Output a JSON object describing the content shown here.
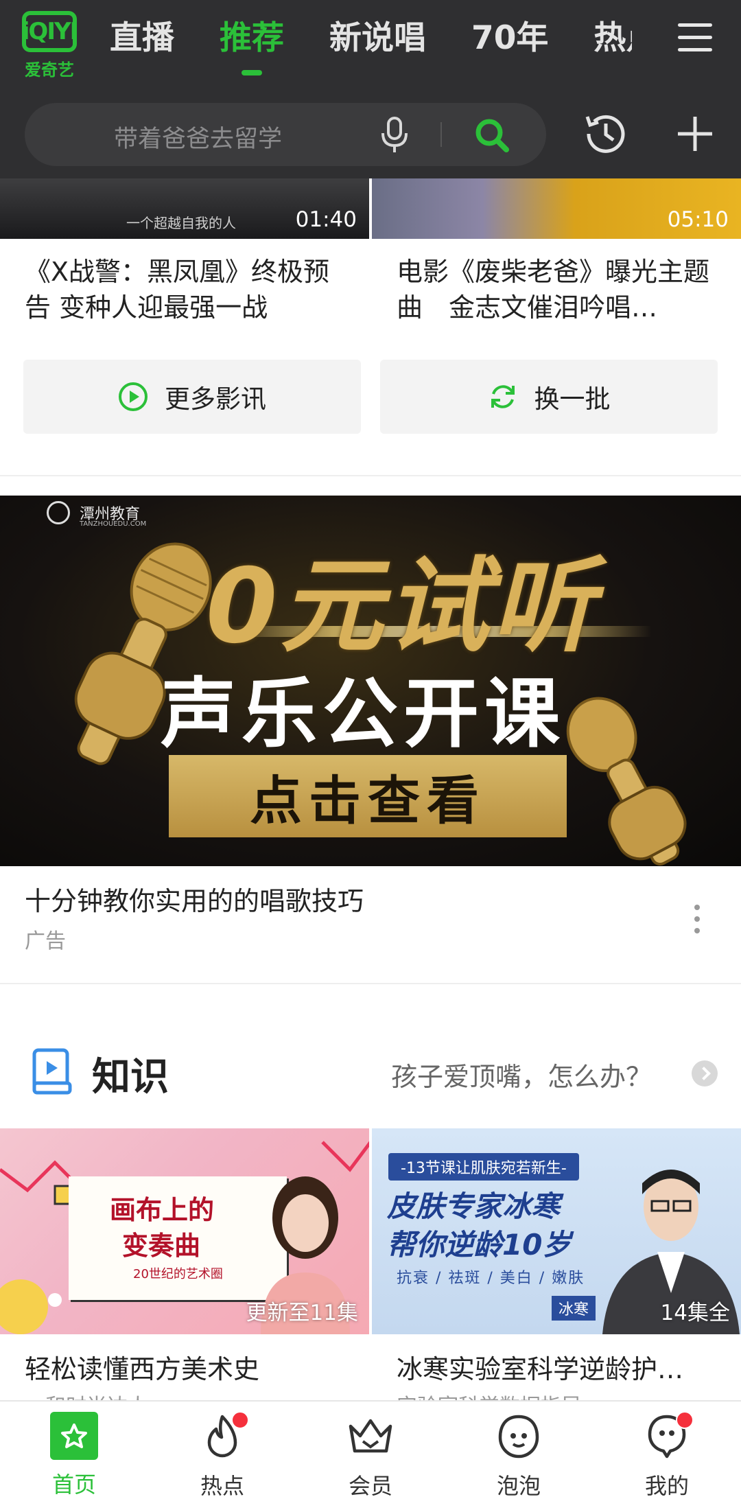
{
  "header": {
    "logo_text": "iQIYI",
    "logo_subtext": "爱奇艺",
    "tabs": [
      "直播",
      "推荐",
      "新说唱",
      "70年",
      "热点"
    ],
    "active_tab_index": 1,
    "accent_color": "#2bc039"
  },
  "search": {
    "placeholder": "带着爸爸去留学",
    "mic_icon": "microphone-icon",
    "search_icon": "search-icon"
  },
  "top_videos": [
    {
      "caption": "一个超越自我的人",
      "duration": "01:40",
      "title": "《X战警：黑凤凰》终极预告 变种人迎最强一战"
    },
    {
      "caption": "",
      "duration": "05:10",
      "title": "电影《废柴老爸》曝光主题曲　金志文催泪吟唱…"
    }
  ],
  "actions": {
    "more_label": "更多影讯",
    "refresh_label": "换一批"
  },
  "ad": {
    "brand": "潭州教育",
    "brand_sub": "TANZHOUEDU.COM",
    "headline": "0元试听",
    "subhead": "声乐公开课",
    "cta": "点击查看",
    "title": "十分钟教你实用的的唱歌技巧",
    "label": "广告"
  },
  "knowledge": {
    "section_title": "知识",
    "promo": "孩子爱顶嘴，怎么办？",
    "cards": [
      {
        "board_line1": "画布上的",
        "board_line2": "变奏曲",
        "board_line3": "20世纪的艺术圈",
        "badge": "更新至11集",
        "title": "轻松读懂西方美术史",
        "subtitle": "…和时尚达人"
      },
      {
        "banner": "-13节课让肌肤宛若新生-",
        "headline1": "皮肤专家冰寒",
        "headline2": "帮你逆龄10岁",
        "sub": "抗衰 / 祛斑 / 美白 / 嫩肤",
        "name": "冰寒",
        "badge": "14集全",
        "title": "冰寒实验室科学逆龄护…",
        "subtitle": "实验室科学数据指导"
      }
    ]
  },
  "bottom_nav": [
    {
      "label": "首页",
      "icon": "home-star-icon",
      "active": true,
      "badge": false
    },
    {
      "label": "热点",
      "icon": "flame-icon",
      "active": false,
      "badge": true
    },
    {
      "label": "会员",
      "icon": "crown-icon",
      "active": false,
      "badge": false
    },
    {
      "label": "泡泡",
      "icon": "bubble-face-icon",
      "active": false,
      "badge": false
    },
    {
      "label": "我的",
      "icon": "profile-icon",
      "active": false,
      "badge": true
    }
  ]
}
